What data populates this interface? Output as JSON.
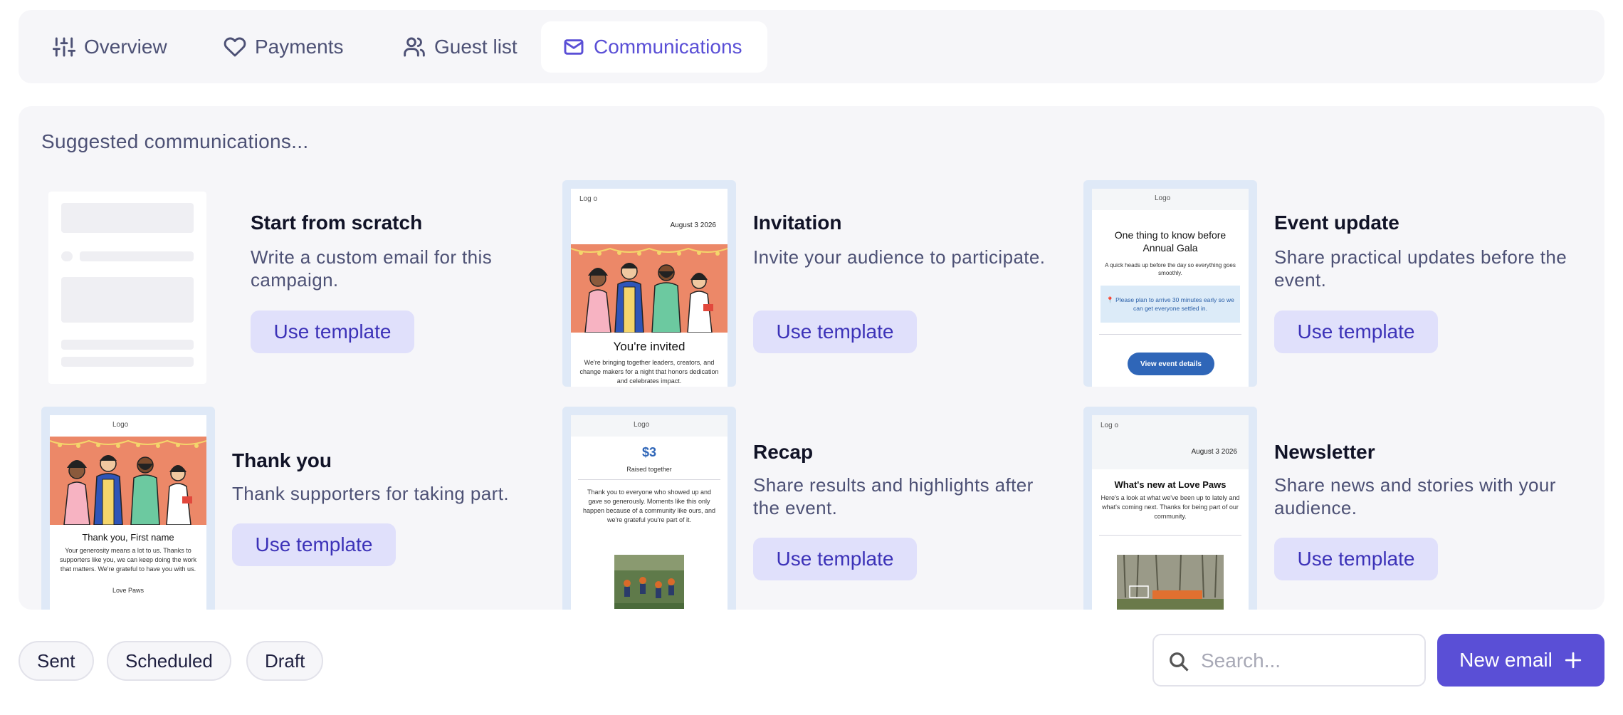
{
  "tabs": [
    {
      "label": "Overview",
      "icon": "sliders-icon"
    },
    {
      "label": "Payments",
      "icon": "heart-icon"
    },
    {
      "label": "Guest list",
      "icon": "users-icon"
    },
    {
      "label": "Communications",
      "icon": "mail-icon"
    }
  ],
  "active_tab": "Communications",
  "suggestions": {
    "title": "Suggested communications...",
    "button_label": "Use template",
    "cards": [
      {
        "name": "Start from scratch",
        "description": "Write a custom email for this campaign."
      },
      {
        "name": "Invitation",
        "description": "Invite your audience to participate.",
        "preview": {
          "logo": "Log o",
          "date": "August 3 2026",
          "headline": "You're invited",
          "body": "We're bringing together leaders, creators, and change makers for a night that honors dedication and celebrates impact."
        }
      },
      {
        "name": "Event update",
        "description": "Share practical updates before the event.",
        "preview": {
          "logo": "Logo",
          "headline": "One thing to know before Annual Gala",
          "intro": "A quick heads up before the day so everything goes smoothly.",
          "notice": "📍 Please plan to arrive 30 minutes early so we can get everyone settled in.",
          "cta": "View event details"
        }
      },
      {
        "name": "Thank you",
        "description": "Thank supporters for taking part.",
        "preview": {
          "logo": "Logo",
          "headline": "Thank you, First name",
          "body": "Your generosity means a lot to us. Thanks to supporters like you, we can keep doing the work that matters. We're grateful to have you with us.",
          "footer": "Love Paws"
        }
      },
      {
        "name": "Recap",
        "description": "Share results and highlights after the event.",
        "preview": {
          "logo": "Logo",
          "amount": "$3",
          "amount_label": "Raised together",
          "body": "Thank you to everyone who showed up and gave so generously. Moments like this only happen because of a community like ours, and we're grateful you're part of it."
        }
      },
      {
        "name": "Newsletter",
        "description": "Share news and stories with your audience.",
        "preview": {
          "logo": "Log o",
          "date": "August 3 2026",
          "headline": "What's new at Love Paws",
          "body": "Here's a look at what we've been up to lately and what's coming next. Thanks for being part of our community."
        }
      }
    ]
  },
  "filters": [
    "Sent",
    "Scheduled",
    "Draft"
  ],
  "search": {
    "placeholder": "Search...",
    "value": ""
  },
  "new_email_label": "New email",
  "colors": {
    "accent": "#5a4fd6",
    "accent_soft": "#e0e0fb",
    "panel_bg": "#f6f6f9",
    "illustration_bg": "#ec8868"
  }
}
